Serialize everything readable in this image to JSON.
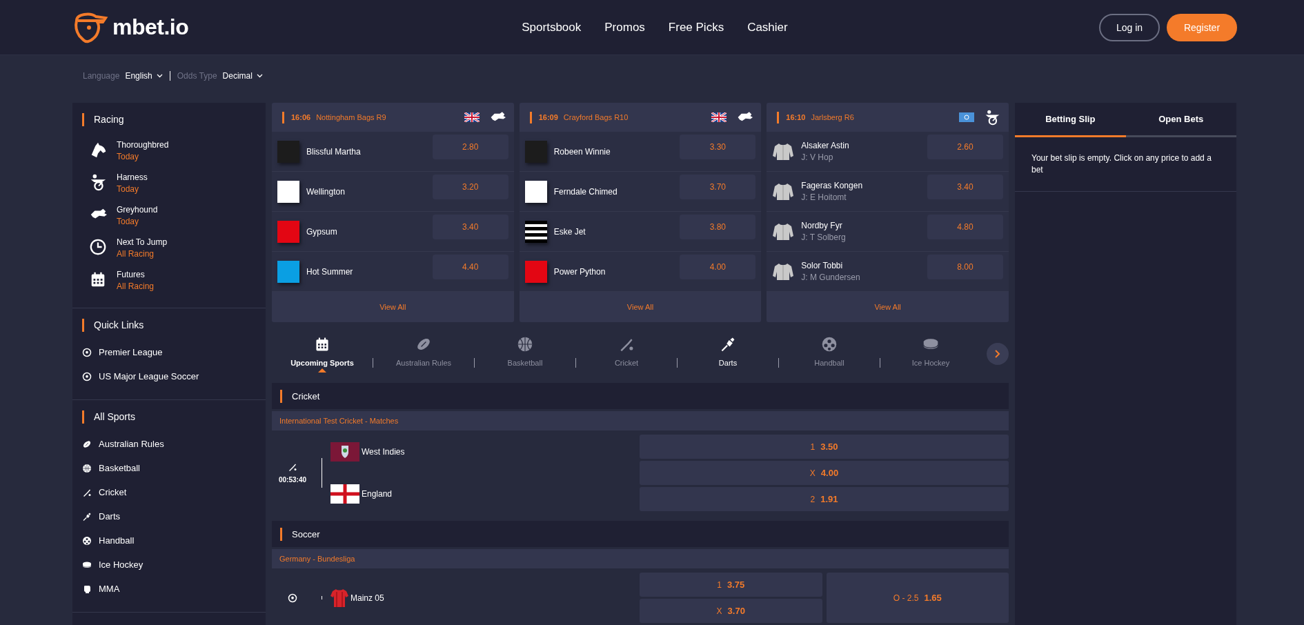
{
  "header": {
    "logo": "mbet.io",
    "nav": [
      "Sportsbook",
      "Promos",
      "Free Picks",
      "Cashier"
    ],
    "login": "Log in",
    "register": "Register"
  },
  "settings": [
    {
      "label": "Language",
      "value": "English"
    },
    {
      "label": "Odds Type",
      "value": "Decimal"
    }
  ],
  "sidebar": [
    {
      "title": "Racing",
      "kind": "racing",
      "items": [
        {
          "label": "Thoroughbred",
          "sub": "Today"
        },
        {
          "label": "Harness",
          "sub": "Today"
        },
        {
          "label": "Greyhound",
          "sub": "Today"
        },
        {
          "label": "Next To Jump",
          "sub": "All Racing"
        },
        {
          "label": "Futures",
          "sub": "All Racing"
        }
      ]
    },
    {
      "title": "Quick Links",
      "kind": "links",
      "items": [
        {
          "label": "Premier League"
        },
        {
          "label": "US Major League Soccer"
        }
      ]
    },
    {
      "title": "All Sports",
      "kind": "links",
      "items": [
        {
          "label": "Australian Rules"
        },
        {
          "label": "Basketball"
        },
        {
          "label": "Cricket"
        },
        {
          "label": "Darts"
        },
        {
          "label": "Handball"
        },
        {
          "label": "Ice Hockey"
        },
        {
          "label": "MMA"
        }
      ]
    }
  ],
  "races": [
    {
      "time": "16:06",
      "name": "Nottingham Bags R9",
      "view_all": "View All",
      "runners": [
        {
          "kind": "swatch",
          "name": "Blissful Martha",
          "color": "#1c1c1c",
          "price": "2.80"
        },
        {
          "kind": "swatch",
          "name": "Wellington",
          "color": "#ffffff",
          "price": "3.20"
        },
        {
          "kind": "swatch",
          "name": "Gypsum",
          "color": "#e30613",
          "price": "3.40"
        },
        {
          "kind": "swatch",
          "name": "Hot Summer",
          "color": "#0a9fe3",
          "price": "4.40"
        }
      ]
    },
    {
      "time": "16:09",
      "name": "Crayford Bags R10",
      "view_all": "View All",
      "runners": [
        {
          "kind": "swatch",
          "name": "Robeen Winnie",
          "color": "#1c1c1c",
          "price": "3.30"
        },
        {
          "kind": "swatch",
          "name": "Ferndale Chimed",
          "color": "#ffffff",
          "price": "3.70"
        },
        {
          "kind": "stripes",
          "name": "Eske Jet",
          "color": "#000000",
          "price": "3.80"
        },
        {
          "kind": "swatch",
          "name": "Power Python",
          "color": "#e30613",
          "price": "4.00"
        }
      ]
    },
    {
      "time": "16:10",
      "name": "Jarlsberg R6",
      "view_all": "View All",
      "runners": [
        {
          "kind": "jacket",
          "name": "Alsaker Astin",
          "jockey": "J: V Hop",
          "price": "2.60"
        },
        {
          "kind": "jacket",
          "name": "Fageras Kongen",
          "jockey": "J: E Hoitomt",
          "price": "3.40"
        },
        {
          "kind": "jacket",
          "name": "Nordby Fyr",
          "jockey": "J: T Solberg",
          "price": "4.80"
        },
        {
          "kind": "jacket",
          "name": "Solor Tobbi",
          "jockey": "J: M Gundersen",
          "price": "8.00"
        }
      ]
    }
  ],
  "sport_tabs": [
    {
      "label": "Upcoming Sports",
      "selected": true,
      "highlighted": false
    },
    {
      "label": "Australian Rules",
      "selected": false,
      "highlighted": false
    },
    {
      "label": "Basketball",
      "selected": false,
      "highlighted": false
    },
    {
      "label": "Cricket",
      "selected": false,
      "highlighted": false
    },
    {
      "label": "Darts",
      "selected": false,
      "highlighted": true
    },
    {
      "label": "Handball",
      "selected": false,
      "highlighted": false
    },
    {
      "label": "Ice Hockey",
      "selected": false,
      "highlighted": false
    }
  ],
  "events": [
    {
      "sport": "Cricket",
      "league": "International Test Cricket - Matches",
      "matches": [
        {
          "time": "00:53:40",
          "teams": [
            "West Indies",
            "England"
          ],
          "odds": [
            {
              "label": "1",
              "price": "3.50"
            },
            {
              "label": "X",
              "price": "4.00"
            },
            {
              "label": "2",
              "price": "1.91"
            }
          ]
        }
      ]
    },
    {
      "sport": "Soccer",
      "league": "Germany - Bundesliga",
      "matches": [
        {
          "teams": [
            "Mainz 05"
          ],
          "odds": [
            {
              "label": "1",
              "price": "3.75"
            },
            {
              "label": "X",
              "price": "3.70"
            }
          ],
          "totals": [
            {
              "label": "O - 2.5",
              "price": "1.65"
            }
          ]
        }
      ]
    }
  ],
  "betslip": {
    "tabs": [
      {
        "label": "Betting Slip",
        "selected": true
      },
      {
        "label": "Open Bets",
        "selected": false
      }
    ],
    "message": "Your bet slip is empty. Click on any price to add a bet"
  }
}
